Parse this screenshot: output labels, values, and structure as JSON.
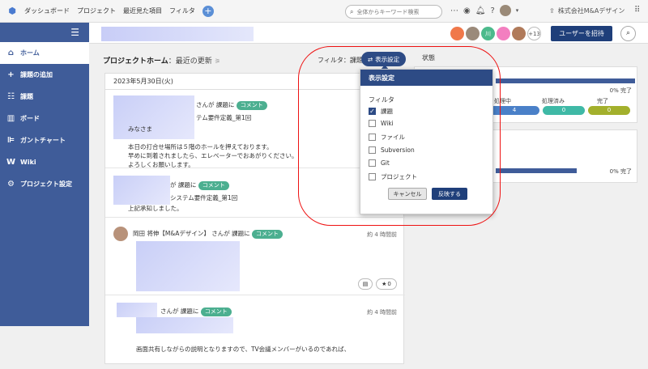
{
  "topbar": {
    "nav": [
      "ダッシュボード",
      "プロジェクト",
      "最近見た項目",
      "フィルタ"
    ],
    "search_placeholder": "全体からキーワード検索",
    "company": "株式会社M&Aデザイン"
  },
  "sidebar": {
    "items": [
      {
        "label": "ホーム",
        "icon": "home-icon"
      },
      {
        "label": "課題の追加",
        "icon": "plus-icon"
      },
      {
        "label": "課題",
        "icon": "list-icon"
      },
      {
        "label": "ボード",
        "icon": "board-icon"
      },
      {
        "label": "ガントチャート",
        "icon": "gantt-icon"
      },
      {
        "label": "Wiki",
        "icon": "wiki-icon"
      },
      {
        "label": "プロジェクト設定",
        "icon": "gear-icon"
      }
    ]
  },
  "header": {
    "avatars": [
      "",
      "",
      "川",
      "",
      ""
    ],
    "more_count": "+13",
    "invite_label": "ユーザーを招待"
  },
  "main": {
    "title": "プロジェクトホーム",
    "subtitle": "：最近の更新",
    "filter_label": "フィルタ：課題",
    "display_settings_label": "表示設定",
    "status_label": "状態",
    "date": "2023年5月30日(火)"
  },
  "feed": [
    {
      "action": "さんが 課題に",
      "badge": "コメント",
      "issue": "テム要件定義_第1回",
      "lines": [
        "みなさま",
        "",
        "本日の打合せ場所は５階のホールを押えております。",
        "早めに到着されましたら、エレベーターでおあがりください。",
        "よろしくお願いします。"
      ]
    },
    {
      "action": "が 課題に",
      "badge": "コメント",
      "issue": "システム要件定義_第1回",
      "lines": [
        "上記承知しました。"
      ]
    },
    {
      "user": "岡田 将伸【M&Aデザイン】",
      "action": "さんが 課題に",
      "badge": "コメント",
      "time": "約 4 時間前",
      "star_count": "0"
    },
    {
      "action": "さんが 課題に",
      "badge": "コメント",
      "time": "約 4 時間前",
      "lines": [
        "画面共有しながらの説明となりますので、TV会議メンバーがいるのであれば、"
      ]
    }
  ],
  "right_panel": {
    "progress1_text": "0% 完了",
    "statuses": [
      {
        "label": "処理中",
        "count": "4",
        "color": "#4a80c8"
      },
      {
        "label": "処理済み",
        "count": "0",
        "color": "#3fb9a6"
      },
      {
        "label": "完了",
        "count": "0",
        "color": "#a3b02c"
      }
    ],
    "progress2_text": "0% 完了"
  },
  "popup": {
    "header": "表示設定",
    "section": "フィルタ",
    "options": [
      {
        "label": "課題",
        "checked": true
      },
      {
        "label": "Wiki",
        "checked": false
      },
      {
        "label": "ファイル",
        "checked": false
      },
      {
        "label": "Subversion",
        "checked": false
      },
      {
        "label": "Git",
        "checked": false
      },
      {
        "label": "プロジェクト",
        "checked": false
      }
    ],
    "cancel_label": "キャンセル",
    "apply_label": "反映する"
  },
  "colors": {
    "sidebar": "#3f5c99",
    "accent": "#2d4b85",
    "badge": "#4caf90",
    "highlight_ring": "#ee1111"
  }
}
